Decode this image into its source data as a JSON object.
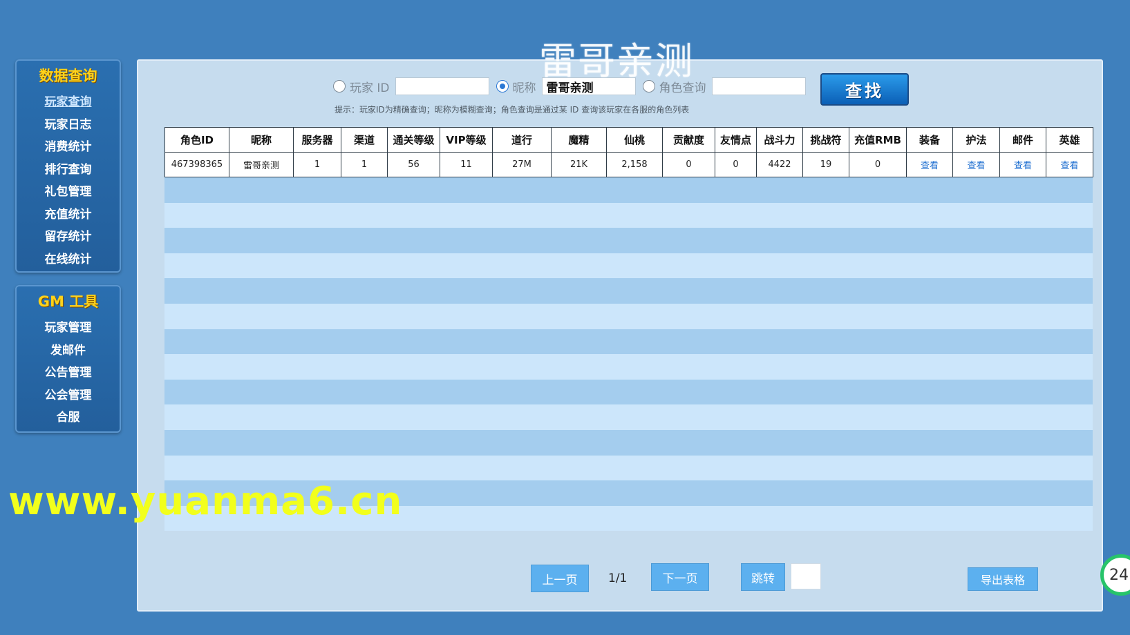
{
  "overlay_title": "雷哥亲测",
  "site_watermark": "www.yuanma6.cn",
  "badge": "24",
  "sidebar": {
    "data_heading": "数据查询",
    "data_items": [
      "玩家查询",
      "玩家日志",
      "消费统计",
      "排行查询",
      "礼包管理",
      "充值统计",
      "留存统计",
      "在线统计"
    ],
    "gm_heading": "GM 工具",
    "gm_items": [
      "玩家管理",
      "发邮件",
      "公告管理",
      "公会管理",
      "合服"
    ]
  },
  "search": {
    "player_id_label": "玩家 ID",
    "player_id_value": "",
    "nickname_label": "昵称",
    "nickname_value": "雷哥亲测",
    "role_label": "角色查询",
    "role_value": "",
    "selected": "nickname",
    "button_label": "查找",
    "hint": "提示：玩家ID为精确查询；昵称为模糊查询；角色查询是通过某 ID 查询该玩家在各服的角色列表"
  },
  "table": {
    "headers": [
      "角色ID",
      "昵称",
      "服务器",
      "渠道",
      "通关等级",
      "VIP等级",
      "道行",
      "魔精",
      "仙桃",
      "贡献度",
      "友情点",
      "战斗力",
      "挑战符",
      "充值RMB",
      "装备",
      "护法",
      "邮件",
      "英雄"
    ],
    "rows": [
      [
        "467398365",
        "雷哥亲测",
        "1",
        "1",
        "56",
        "11",
        "27M",
        "21K",
        "2,158",
        "0",
        "0",
        "4422",
        "19",
        "0",
        "查看",
        "查看",
        "查看",
        "查看"
      ]
    ]
  },
  "pager": {
    "prev": "上一页",
    "info": "1/1",
    "next": "下一页",
    "jump": "跳转",
    "export": "导出表格"
  },
  "colors": {
    "background": "#3f80bd",
    "panel": "#c6dcee",
    "stripe_dark": "#a4cdee",
    "stripe_light": "#cce6fb",
    "accent_heading": "#ffd21a",
    "link": "#1f6fd0",
    "button": "#5cb0ef"
  }
}
